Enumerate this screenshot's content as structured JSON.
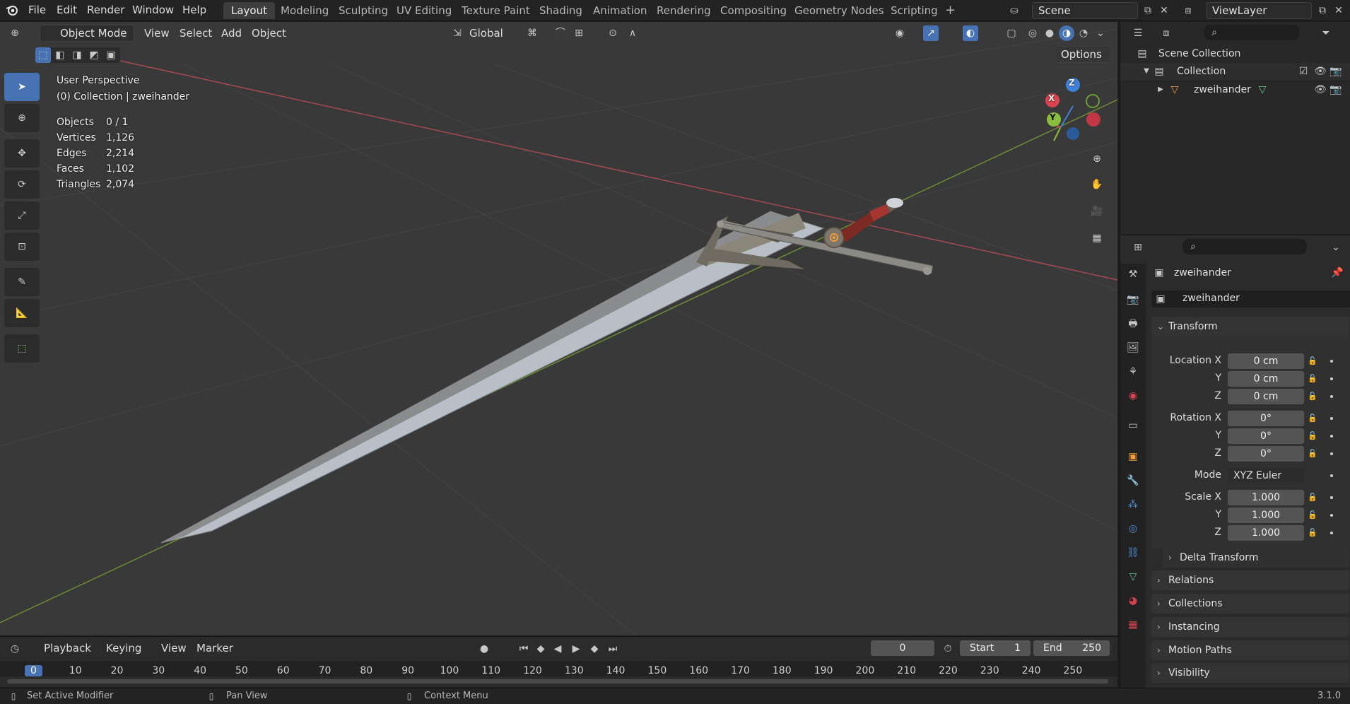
{
  "menubar": {
    "items": [
      "File",
      "Edit",
      "Render",
      "Window",
      "Help"
    ],
    "workspaces": [
      "Layout",
      "Modeling",
      "Sculpting",
      "UV Editing",
      "Texture Paint",
      "Shading",
      "Animation",
      "Rendering",
      "Compositing",
      "Geometry Nodes",
      "Scripting"
    ],
    "active_workspace": "Layout",
    "add_tab": "+",
    "scene": "Scene",
    "view_layer": "ViewLayer"
  },
  "viewport": {
    "mode": "Object Mode",
    "menus": [
      "View",
      "Select",
      "Add",
      "Object"
    ],
    "transform_orientation": "Global",
    "options": "Options",
    "perspective": "User Perspective",
    "collection_info": "(0) Collection | zweihander",
    "stats": [
      {
        "label": "Objects",
        "value": "0 / 1"
      },
      {
        "label": "Vertices",
        "value": "1,126"
      },
      {
        "label": "Edges",
        "value": "2,214"
      },
      {
        "label": "Faces",
        "value": "1,102"
      },
      {
        "label": "Triangles",
        "value": "2,074"
      }
    ],
    "gizmo": {
      "x": "X",
      "y": "Y",
      "z": "Z"
    },
    "axis_colors": {
      "x": "#d9434f",
      "y": "#8bbd3d",
      "z": "#3f80d9"
    }
  },
  "outliner": {
    "scene_collection": "Scene Collection",
    "collection": "Collection",
    "object": "zweihander"
  },
  "properties": {
    "object_name": "zweihander",
    "datablock": "zweihander",
    "transform": {
      "title": "Transform",
      "location": {
        "label": "Location X",
        "x": "0 cm",
        "y": "0 cm",
        "z": "0 cm"
      },
      "rotation": {
        "label": "Rotation X",
        "x": "0°",
        "y": "0°",
        "z": "0°"
      },
      "mode_label": "Mode",
      "mode": "XYZ Euler",
      "scale": {
        "label": "Scale X",
        "x": "1.000",
        "y": "1.000",
        "z": "1.000"
      },
      "y_label": "Y",
      "z_label": "Z"
    },
    "sections": [
      "Delta Transform",
      "Relations",
      "Collections",
      "Instancing",
      "Motion Paths",
      "Visibility"
    ]
  },
  "timeline": {
    "menus": [
      "Playback",
      "Keying",
      "View",
      "Marker"
    ],
    "current_frame": "0",
    "start_label": "Start",
    "start": "1",
    "end_label": "End",
    "end": "250",
    "ruler": [
      "0",
      "10",
      "20",
      "30",
      "40",
      "50",
      "60",
      "70",
      "80",
      "90",
      "100",
      "110",
      "120",
      "130",
      "140",
      "150",
      "160",
      "170",
      "180",
      "190",
      "200",
      "210",
      "220",
      "230",
      "240",
      "250"
    ]
  },
  "statusbar": {
    "left": "Set Active Modifier",
    "middle": "Pan View",
    "right": "Context Menu",
    "version": "3.1.0"
  }
}
